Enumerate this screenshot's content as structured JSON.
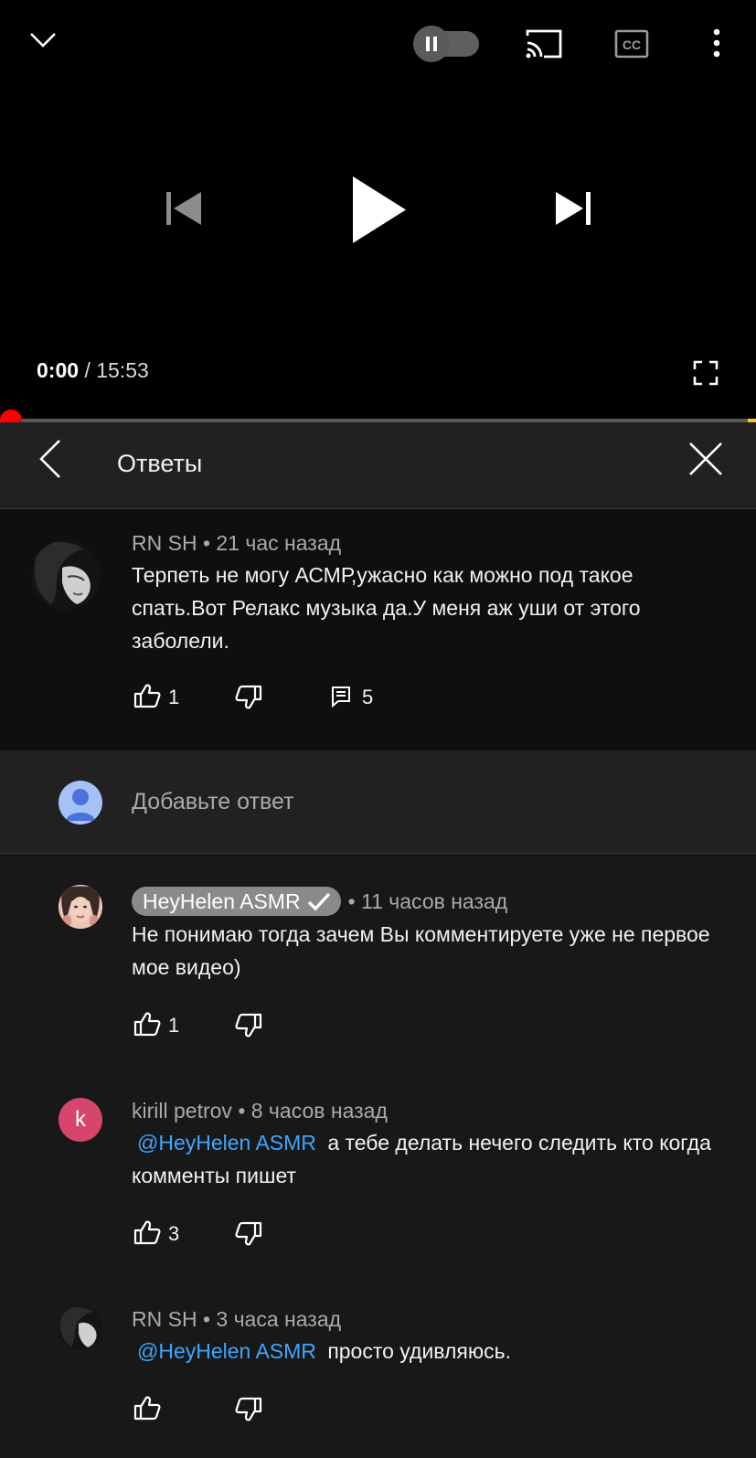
{
  "player": {
    "icons": {
      "minimize": "chevron-down-icon",
      "autoplay": "autoplay-pause-toggle",
      "cast": "cast-icon",
      "captions": "cc-icon",
      "more": "more-vert-icon",
      "previous": "skip-previous-icon",
      "play": "play-icon",
      "next": "skip-next-icon",
      "fullscreen": "fullscreen-icon"
    },
    "current_time": "0:00",
    "time_separator": "/",
    "duration": "15:53",
    "progress": 0
  },
  "replies_panel": {
    "title": "Ответы"
  },
  "parent_comment": {
    "author": "RN SH",
    "time": "• 21 час назад",
    "text": "Терпеть не могу АСМР,ужасно как можно под такое спать.Вот Релакс музыка да.У меня аж уши от этого заболели.",
    "likes": "1",
    "replies": "5"
  },
  "add_reply": {
    "placeholder": "Добавьте ответ"
  },
  "replies": [
    {
      "author": "HeyHelen ASMR",
      "verified": true,
      "time": "• 11 часов назад",
      "text": "Не понимаю тогда зачем Вы комментируете уже не первое мое видео)",
      "likes": "1"
    },
    {
      "author": "kirill petrov",
      "avatar_letter": "k",
      "avatar_color": "#d6456b",
      "time": "• 8 часов назад",
      "mention": "@HeyHelen ASMR",
      "text": "а тебе делать нечего следить кто когда комменты пишет",
      "likes": "3"
    },
    {
      "author": "RN SH",
      "time": "• 3 часа назад",
      "mention": "@HeyHelen ASMR",
      "text": "просто удивляюсь."
    }
  ],
  "colors": {
    "accent_red": "#ff0000",
    "mention_blue": "#3ea6ff",
    "buffer_yellow": "#f2c437"
  }
}
